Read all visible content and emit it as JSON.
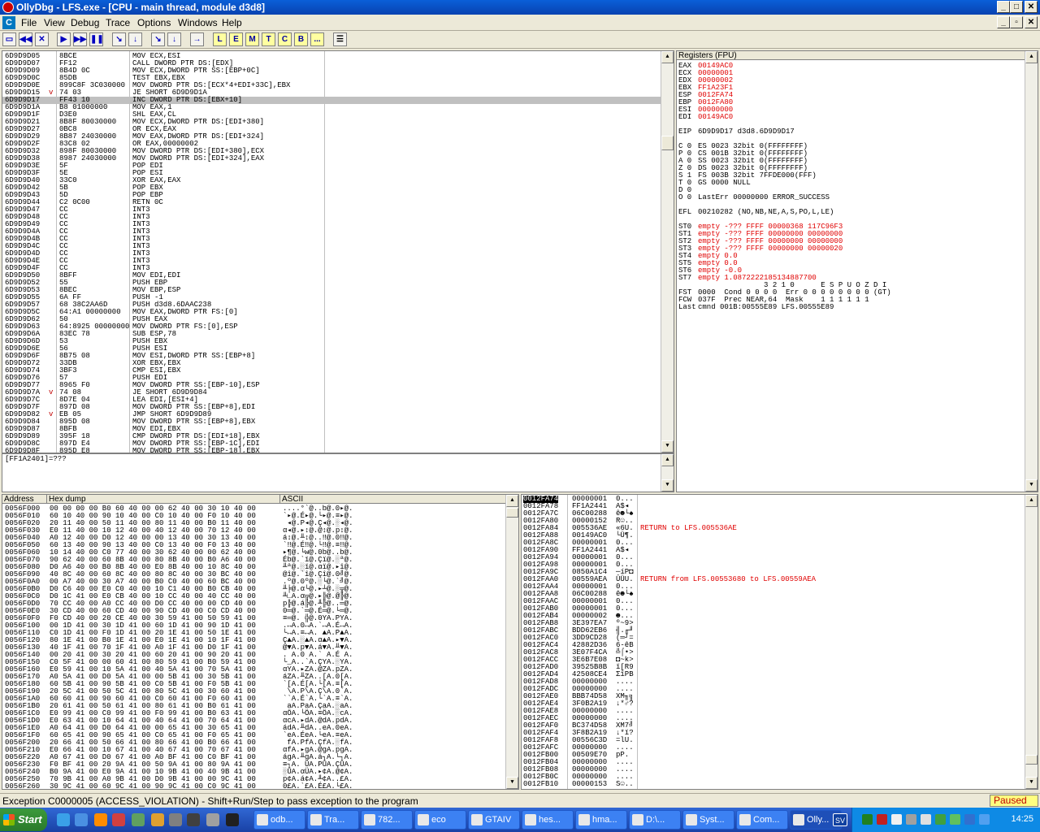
{
  "window": {
    "title": "OllyDbg - LFS.exe - [CPU - main thread, module d3d8]"
  },
  "menu": {
    "mdi_icon": "C",
    "items": [
      "File",
      "View",
      "Debug",
      "Trace",
      "Options",
      "Windows",
      "Help"
    ]
  },
  "toolbar": {
    "buttons": [
      {
        "name": "open",
        "glyph": "▭"
      },
      {
        "name": "restart",
        "glyph": "◀◀"
      },
      {
        "name": "close",
        "glyph": "✕"
      },
      {
        "name": "run",
        "glyph": "▶"
      },
      {
        "name": "step-run",
        "glyph": "▶▶"
      },
      {
        "name": "pause",
        "glyph": "❚❚"
      },
      {
        "name": "step-into",
        "glyph": "↘"
      },
      {
        "name": "step-over",
        "glyph": "↓"
      },
      {
        "name": "trace-into",
        "glyph": "↘"
      },
      {
        "name": "trace-over",
        "glyph": "↓"
      },
      {
        "name": "execute-till-return",
        "glyph": "→"
      }
    ],
    "letters": [
      "L",
      "E",
      "M",
      "T",
      "C",
      "B",
      "..."
    ],
    "list_glyph": "☰"
  },
  "disasm": {
    "selected_index": 6,
    "rows": [
      [
        "6D9D9D05",
        "",
        "8BCE",
        "MOV ECX,ESI"
      ],
      [
        "6D9D9D07",
        "",
        "FF12",
        "CALL DWORD PTR DS:[EDX]"
      ],
      [
        "6D9D9D09",
        "",
        "8B4D 0C",
        "MOV ECX,DWORD PTR SS:[EBP+0C]"
      ],
      [
        "6D9D9D0C",
        "",
        "85DB",
        "TEST EBX,EBX"
      ],
      [
        "6D9D9D0E",
        "",
        "899C8F 3C030000",
        "MOV DWORD PTR DS:[ECX*4+EDI+33C],EBX"
      ],
      [
        "6D9D9D15",
        "v",
        "74 03",
        "JE SHORT 6D9D9D1A"
      ],
      [
        "6D9D9D17",
        "",
        "FF43 10",
        "INC DWORD PTR DS:[EBX+10]"
      ],
      [
        "6D9D9D1A",
        "",
        "B8 01000000",
        "MOV EAX,1"
      ],
      [
        "6D9D9D1F",
        "",
        "D3E0",
        "SHL EAX,CL"
      ],
      [
        "6D9D9D21",
        "",
        "8B8F 80030000",
        "MOV ECX,DWORD PTR DS:[EDI+380]"
      ],
      [
        "6D9D9D27",
        "",
        "0BC8",
        "OR ECX,EAX"
      ],
      [
        "6D9D9D29",
        "",
        "8B87 24030000",
        "MOV EAX,DWORD PTR DS:[EDI+324]"
      ],
      [
        "6D9D9D2F",
        "",
        "83C8 02",
        "OR EAX,00000002"
      ],
      [
        "6D9D9D32",
        "",
        "898F 80030000",
        "MOV DWORD PTR DS:[EDI+380],ECX"
      ],
      [
        "6D9D9D38",
        "",
        "8987 24030000",
        "MOV DWORD PTR DS:[EDI+324],EAX"
      ],
      [
        "6D9D9D3E",
        "",
        "5F",
        "POP EDI"
      ],
      [
        "6D9D9D3F",
        "",
        "5E",
        "POP ESI"
      ],
      [
        "6D9D9D40",
        "",
        "33C0",
        "XOR EAX,EAX"
      ],
      [
        "6D9D9D42",
        "",
        "5B",
        "POP EBX"
      ],
      [
        "6D9D9D43",
        "",
        "5D",
        "POP EBP"
      ],
      [
        "6D9D9D44",
        "",
        "C2 0C00",
        "RETN 0C"
      ],
      [
        "6D9D9D47",
        "",
        "CC",
        "INT3"
      ],
      [
        "6D9D9D48",
        "",
        "CC",
        "INT3"
      ],
      [
        "6D9D9D49",
        "",
        "CC",
        "INT3"
      ],
      [
        "6D9D9D4A",
        "",
        "CC",
        "INT3"
      ],
      [
        "6D9D9D4B",
        "",
        "CC",
        "INT3"
      ],
      [
        "6D9D9D4C",
        "",
        "CC",
        "INT3"
      ],
      [
        "6D9D9D4D",
        "",
        "CC",
        "INT3"
      ],
      [
        "6D9D9D4E",
        "",
        "CC",
        "INT3"
      ],
      [
        "6D9D9D4F",
        "",
        "CC",
        "INT3"
      ],
      [
        "6D9D9D50",
        "",
        "8BFF",
        "MOV EDI,EDI"
      ],
      [
        "6D9D9D52",
        "",
        "55",
        "PUSH EBP"
      ],
      [
        "6D9D9D53",
        "",
        "8BEC",
        "MOV EBP,ESP"
      ],
      [
        "6D9D9D55",
        "",
        "6A FF",
        "PUSH -1"
      ],
      [
        "6D9D9D57",
        "",
        "68 38C2AA6D",
        "PUSH d3d8.6DAAC238"
      ],
      [
        "6D9D9D5C",
        "",
        "64:A1 00000000",
        "MOV EAX,DWORD PTR FS:[0]"
      ],
      [
        "6D9D9D62",
        "",
        "50",
        "PUSH EAX"
      ],
      [
        "6D9D9D63",
        "",
        "64:8925 00000000",
        "MOV DWORD PTR FS:[0],ESP"
      ],
      [
        "6D9D9D6A",
        "",
        "83EC 78",
        "SUB ESP,78"
      ],
      [
        "6D9D9D6D",
        "",
        "53",
        "PUSH EBX"
      ],
      [
        "6D9D9D6E",
        "",
        "56",
        "PUSH ESI"
      ],
      [
        "6D9D9D6F",
        "",
        "8B75 08",
        "MOV ESI,DWORD PTR SS:[EBP+8]"
      ],
      [
        "6D9D9D72",
        "",
        "33DB",
        "XOR EBX,EBX"
      ],
      [
        "6D9D9D74",
        "",
        "3BF3",
        "CMP ESI,EBX"
      ],
      [
        "6D9D9D76",
        "",
        "57",
        "PUSH EDI"
      ],
      [
        "6D9D9D77",
        "",
        "8965 F0",
        "MOV DWORD PTR SS:[EBP-10],ESP"
      ],
      [
        "6D9D9D7A",
        "v",
        "74 08",
        "JE SHORT 6D9D9D84"
      ],
      [
        "6D9D9D7C",
        "",
        "8D7E 04",
        "LEA EDI,[ESI+4]"
      ],
      [
        "6D9D9D7F",
        "",
        "897D 08",
        "MOV DWORD PTR SS:[EBP+8],EDI"
      ],
      [
        "6D9D9D82",
        "v",
        "EB 05",
        "JMP SHORT 6D9D9D89"
      ],
      [
        "6D9D9D84",
        "",
        "895D 08",
        "MOV DWORD PTR SS:[EBP+8],EBX"
      ],
      [
        "6D9D9D87",
        "",
        "8BFB",
        "MOV EDI,EBX"
      ],
      [
        "6D9D9D89",
        "",
        "395F 18",
        "CMP DWORD PTR DS:[EDI+18],EBX"
      ],
      [
        "6D9D9D8C",
        "",
        "897D E4",
        "MOV DWORD PTR SS:[EBP-1C],EDI"
      ],
      [
        "6D9D9D8F",
        "",
        "895D E8",
        "MOV DWORD PTR SS:[EBP-18],EBX"
      ]
    ]
  },
  "info": {
    "text": "[FF1A2401]=???"
  },
  "registers": {
    "header": "Registers (FPU)",
    "lines": [
      {
        "k": "EAX",
        "v": "00149AC0",
        "r": true
      },
      {
        "k": "ECX",
        "v": "00000001",
        "r": true
      },
      {
        "k": "EDX",
        "v": "00000002",
        "r": true
      },
      {
        "k": "EBX",
        "v": "FF1A23F1",
        "r": true
      },
      {
        "k": "ESP",
        "v": "0012FA74",
        "r": true
      },
      {
        "k": "EBP",
        "v": "0012FA80",
        "r": true
      },
      {
        "k": "ESI",
        "v": "00000000",
        "r": true
      },
      {
        "k": "EDI",
        "v": "00149AC0",
        "r": true
      },
      {
        "k": "",
        "v": "",
        "r": false
      },
      {
        "k": "EIP",
        "v": "6D9D9D17 d3d8.6D9D9D17",
        "r": false
      },
      {
        "k": "",
        "v": "",
        "r": false
      },
      {
        "k": "C 0",
        "v": "ES 0023 32bit 0(FFFFFFFF)",
        "r": false
      },
      {
        "k": "P 0",
        "v": "CS 001B 32bit 0(FFFFFFFF)",
        "r": false
      },
      {
        "k": "A 0",
        "v": "SS 0023 32bit 0(FFFFFFFF)",
        "r": false
      },
      {
        "k": "Z 0",
        "v": "DS 0023 32bit 0(FFFFFFFF)",
        "r": false
      },
      {
        "k": "S 1",
        "v": "FS 003B 32bit 7FFDE000(FFF)",
        "r": false
      },
      {
        "k": "T 0",
        "v": "GS 0000 NULL",
        "r": false
      },
      {
        "k": "D 0",
        "v": "",
        "r": false
      },
      {
        "k": "O 0",
        "v": "LastErr 00000000 ERROR_SUCCESS",
        "r": false
      },
      {
        "k": "",
        "v": "",
        "r": false
      },
      {
        "k": "EFL",
        "v": "00210282 (NO,NB,NE,A,S,PO,L,LE)",
        "r": false
      },
      {
        "k": "",
        "v": "",
        "r": false
      },
      {
        "k": "ST0",
        "v": "empty -??? FFFF 00000368 117C96F3",
        "r": true
      },
      {
        "k": "ST1",
        "v": "empty -??? FFFF 00000000 00000000",
        "r": true
      },
      {
        "k": "ST2",
        "v": "empty -??? FFFF 00000000 00000000",
        "r": true
      },
      {
        "k": "ST3",
        "v": "empty -??? FFFF 00000000 00000020",
        "r": true
      },
      {
        "k": "ST4",
        "v": "empty 0.0",
        "r": true
      },
      {
        "k": "ST5",
        "v": "empty 0.0",
        "r": true
      },
      {
        "k": "ST6",
        "v": "empty -0.0",
        "r": true
      },
      {
        "k": "ST7",
        "v": "empty 1.0872222185134887700",
        "r": true
      },
      {
        "k": "",
        "v": "               3 2 1 0      E S P U O Z D I",
        "r": false
      },
      {
        "k": "FST",
        "v": "0000  Cond 0 0 0 0  Err 0 0 0 0 0 0 0 0 (GT)",
        "r": false
      },
      {
        "k": "FCW",
        "v": "037F  Prec NEAR,64  Mask    1 1 1 1 1 1",
        "r": false
      },
      {
        "k": "Last",
        "v": "cmnd 001B:00555E89 LFS.00555E89",
        "r": false
      }
    ]
  },
  "dump": {
    "headers": [
      "Address",
      "Hex dump",
      "ASCII"
    ],
    "rows": [
      [
        "0056F000",
        "00 00 00 00 B0 60 40 00 00 62 40 00 30 10 40 00",
        "....°`@..b@.0▸@."
      ],
      [
        "0056F010",
        "60 10 40 00 90 10 40 00 C0 10 40 00 F0 10 40 00",
        "`▸@.É▸@.└▸@.≡▸@."
      ],
      [
        "0056F020",
        "20 11 40 00 50 11 40 00 80 11 40 00 B0 11 40 00",
        " ◂@.P◂@.Ç◂@.░◂@."
      ],
      [
        "0056F030",
        "E0 11 40 00 10 12 40 00 40 12 40 00 70 12 40 00",
        "α◂@.▸↕@.@↕@.p↕@."
      ],
      [
        "0056F040",
        "A0 12 40 00 D0 12 40 00 00 13 40 00 30 13 40 00",
        "á↕@.╨↕@..‼@.0‼@."
      ],
      [
        "0056F050",
        "60 13 40 00 90 13 40 00 C0 13 40 00 F0 13 40 00",
        "`‼@.É‼@.└‼@.≡‼@."
      ],
      [
        "0056F060",
        "10 14 40 00 C0 77 40 00 30 62 40 00 00 62 40 00",
        "▸¶@.└w@.0b@..b@."
      ],
      [
        "0056F070",
        "90 62 40 00 60 8B 40 00 80 8B 40 00 B0 A6 40 00",
        "Éb@.`ï@.Çï@.░ª@."
      ],
      [
        "0056F080",
        "D0 A6 40 00 B0 8B 40 00 E0 8B 40 00 10 8C 40 00",
        "╨ª@.░ï@.αï@.▸î@."
      ],
      [
        "0056F090",
        "40 8C 40 00 60 8C 40 00 80 8C 40 00 30 BC 40 00",
        "@î@.`î@.Çî@.0╝@."
      ],
      [
        "0056F0A0",
        "00 A7 40 00 30 A7 40 00 B0 C0 40 00 60 BC 40 00",
        ".º@.0º@.░└@.`╝@."
      ],
      [
        "0056F0B0",
        "D0 C6 40 00 E0 C0 40 00 10 C1 40 00 B0 CB 40 00",
        "╨╞@.α└@.▸┴@.░╦@."
      ],
      [
        "0056F0C0",
        "D0 1C 41 00 E0 CB 40 00 10 CC 40 00 40 CC 40 00",
        "╨∟A.α╦@.▸╠@.@╠@."
      ],
      [
        "0056F0D0",
        "70 CC 40 00 A0 CC 40 00 D0 CC 40 00 00 CD 40 00",
        "p╠@.á╠@.╨╠@..═@."
      ],
      [
        "0056F0E0",
        "30 CD 40 00 60 CD 40 00 90 CD 40 00 C0 CD 40 00",
        "0═@.`═@.É═@.└═@."
      ],
      [
        "0056F0F0",
        "F0 CD 40 00 20 CE 40 00 30 59 41 00 50 59 41 00",
        "≡═@. ╬@.0YA.PYA."
      ],
      [
        "0056F100",
        "00 1D 41 00 30 1D 41 00 60 1D 41 00 90 1D 41 00",
        ".↔A.0↔A.`↔A.É↔A."
      ],
      [
        "0056F110",
        "C0 1D 41 00 F0 1D 41 00 20 1E 41 00 50 1E 41 00",
        "└↔A.≡↔A. ▲A.P▲A."
      ],
      [
        "0056F120",
        "80 1E 41 00 B0 1E 41 00 E0 1E 41 00 10 1F 41 00",
        "Ç▲A.░▲A.α▲A.▸▼A."
      ],
      [
        "0056F130",
        "40 1F 41 00 70 1F 41 00 A0 1F 41 00 D0 1F 41 00",
        "@▼A.p▼A.á▼A.╨▼A."
      ],
      [
        "0056F140",
        "00 20 41 00 30 20 41 00 60 20 41 00 90 20 41 00",
        ". A.0 A.` A.É A."
      ],
      [
        "0056F150",
        "C0 5F 41 00 00 60 41 00 80 59 41 00 B0 59 41 00",
        "└_A..`A.ÇYA.░YA."
      ],
      [
        "0056F160",
        "E0 59 41 00 10 5A 41 00 40 5A 41 00 70 5A 41 00",
        "αYA.▸ZA.@ZA.pZA."
      ],
      [
        "0056F170",
        "A0 5A 41 00 D0 5A 41 00 00 5B 41 00 30 5B 41 00",
        "áZA.╨ZA..[A.0[A."
      ],
      [
        "0056F180",
        "60 5B 41 00 90 5B 41 00 C0 5B 41 00 F0 5B 41 00",
        "`[A.É[A.└[A.≡[A."
      ],
      [
        "0056F190",
        "20 5C 41 00 50 5C 41 00 80 5C 41 00 30 60 41 00",
        " \\A.P\\A.Ç\\A.0`A."
      ],
      [
        "0056F1A0",
        "60 60 41 00 90 60 41 00 C0 60 41 00 F0 60 41 00",
        "``A.É`A.└`A.≡`A."
      ],
      [
        "0056F1B0",
        "20 61 41 00 50 61 41 00 80 61 41 00 B0 61 41 00",
        " aA.PaA.ÇaA.░aA."
      ],
      [
        "0056F1C0",
        "E0 99 41 00 C0 99 41 00 F0 99 41 00 B0 63 41 00",
        "αÖA.└ÖA.≡ÖA.░cA."
      ],
      [
        "0056F1D0",
        "E0 63 41 00 10 64 41 00 40 64 41 00 70 64 41 00",
        "αcA.▸dA.@dA.pdA."
      ],
      [
        "0056F1E0",
        "A0 64 41 00 D0 64 41 00 00 65 41 00 30 65 41 00",
        "ádA.╨dA..eA.0eA."
      ],
      [
        "0056F1F0",
        "60 65 41 00 90 65 41 00 C0 65 41 00 F0 65 41 00",
        "`eA.ÉeA.└eA.≡eA."
      ],
      [
        "0056F200",
        "20 66 41 00 50 66 41 00 80 66 41 00 B0 66 41 00",
        " fA.PfA.ÇfA.░fA."
      ],
      [
        "0056F210",
        "E0 66 41 00 10 67 41 00 40 67 41 00 70 67 41 00",
        "αfA.▸gA.@gA.pgA."
      ],
      [
        "0056F220",
        "A0 67 41 00 D0 67 41 00 A0 BF 41 00 C0 BF 41 00",
        "ágA.╨gA.á┐A.└┐A."
      ],
      [
        "0056F230",
        "F0 BF 41 00 20 9A 41 00 50 9A 41 00 80 9A 41 00",
        "≡┐A. ÜA.PÜA.ÇÜA."
      ],
      [
        "0056F240",
        "B0 9A 41 00 E0 9A 41 00 10 9B 41 00 40 9B 41 00",
        "░ÜA.αÜA.▸¢A.@¢A."
      ],
      [
        "0056F250",
        "70 9B 41 00 A0 9B 41 00 D0 9B 41 00 00 9C 41 00",
        "p¢A.á¢A.╨¢A..£A."
      ],
      [
        "0056F260",
        "30 9C 41 00 60 9C 41 00 90 9C 41 00 C0 9C 41 00",
        "0£A.`£A.É£A.└£A."
      ]
    ]
  },
  "stack": {
    "selected_index": 0,
    "rows": [
      [
        "0012FA74",
        "00000001",
        "0...",
        ""
      ],
      [
        "0012FA78",
        "FF1A2441",
        "A$◂ ",
        ""
      ],
      [
        "0012FA7C",
        "06C00288",
        "ê☻└♠",
        ""
      ],
      [
        "0012FA80",
        "00000152",
        "R☺..",
        ""
      ],
      [
        "0012FA84",
        "005536AE",
        "«6U.",
        "RETURN to LFS.005536AE"
      ],
      [
        "0012FA88",
        "00149AC0",
        "└Ü¶.",
        ""
      ],
      [
        "0012FA8C",
        "00000001",
        "0...",
        ""
      ],
      [
        "0012FA90",
        "FF1A2441",
        "A$◂ ",
        ""
      ],
      [
        "0012FA94",
        "00000001",
        "0...",
        ""
      ],
      [
        "0012FA98",
        "00000001",
        "0...",
        ""
      ],
      [
        "0012FA9C",
        "0850A1C4",
        "─íP◘",
        ""
      ],
      [
        "0012FAA0",
        "00559AEA",
        "ÛÜU.",
        "RETURN from LFS.00553680 to LFS.00559AEA"
      ],
      [
        "0012FAA4",
        "00000001",
        "0...",
        ""
      ],
      [
        "0012FAA8",
        "06C00288",
        "ê☻└♠",
        ""
      ],
      [
        "0012FAAC",
        "00000001",
        "0...",
        ""
      ],
      [
        "0012FAB0",
        "00000001",
        "0...",
        ""
      ],
      [
        "0012FAB4",
        "00000002",
        "☻...",
        ""
      ],
      [
        "0012FAB8",
        "3E397EA7",
        "º~9>",
        ""
      ],
      [
        "0012FABC",
        "BDD62EB6",
        "╢.╓╜",
        ""
      ],
      [
        "0012FAC0",
        "3DD9CD28",
        "(═┘=",
        ""
      ],
      [
        "0012FAC4",
        "42882D36",
        "6-êB",
        ""
      ],
      [
        "0012FAC8",
        "3E07F4CA",
        "╩⌠•>",
        ""
      ],
      [
        "0012FACC",
        "3E6B7E08",
        "◘~k>",
        ""
      ],
      [
        "0012FAD0",
        "39525B8B",
        "ï[R9",
        ""
      ],
      [
        "0012FAD4",
        "42508CE4",
        "ΣîPB",
        ""
      ],
      [
        "0012FAD8",
        "00000000",
        "....",
        ""
      ],
      [
        "0012FADC",
        "00000000",
        "....",
        ""
      ],
      [
        "0012FAE0",
        "BBB74D58",
        "XM╖╗",
        ""
      ],
      [
        "0012FAE4",
        "3F0B2A19",
        "↓*♂?",
        ""
      ],
      [
        "0012FAE8",
        "00000000",
        "....",
        ""
      ],
      [
        "0012FAEC",
        "00000000",
        "....",
        ""
      ],
      [
        "0012FAF0",
        "BC374D58",
        "XM7╝",
        ""
      ],
      [
        "0012FAF4",
        "3F8B2A19",
        "↓*ï?",
        ""
      ],
      [
        "0012FAF8",
        "00556C3D",
        "=lU.",
        ""
      ],
      [
        "0012FAFC",
        "00000000",
        "....",
        ""
      ],
      [
        "0012FB00",
        "00509E70",
        "pP.",
        ""
      ],
      [
        "0012FB04",
        "00000000",
        "....",
        ""
      ],
      [
        "0012FB08",
        "00000000",
        "....",
        ""
      ],
      [
        "0012FB0C",
        "00000000",
        "....",
        ""
      ],
      [
        "0012FB10",
        "00000153",
        "S☺..",
        ""
      ]
    ]
  },
  "status": {
    "message": "Exception C0000005 (ACCESS_VIOLATION) - Shift+Run/Step to pass exception to the program",
    "state": "Paused"
  },
  "taskbar": {
    "start_label": "Start",
    "tasks": [
      "odb...",
      "Tra...",
      "782...",
      "eco",
      "GTAIV",
      "hes...",
      "hma...",
      "D:\\...",
      "Syst...",
      "Com...",
      "Olly..."
    ],
    "active_task": 10,
    "tray_badge": "SV",
    "clock": "14:25"
  },
  "colors": {
    "titlebar": "#0842b0",
    "register_changed": "#e00000",
    "paused_bg": "#ffff80",
    "taskbar": "#245edb"
  }
}
